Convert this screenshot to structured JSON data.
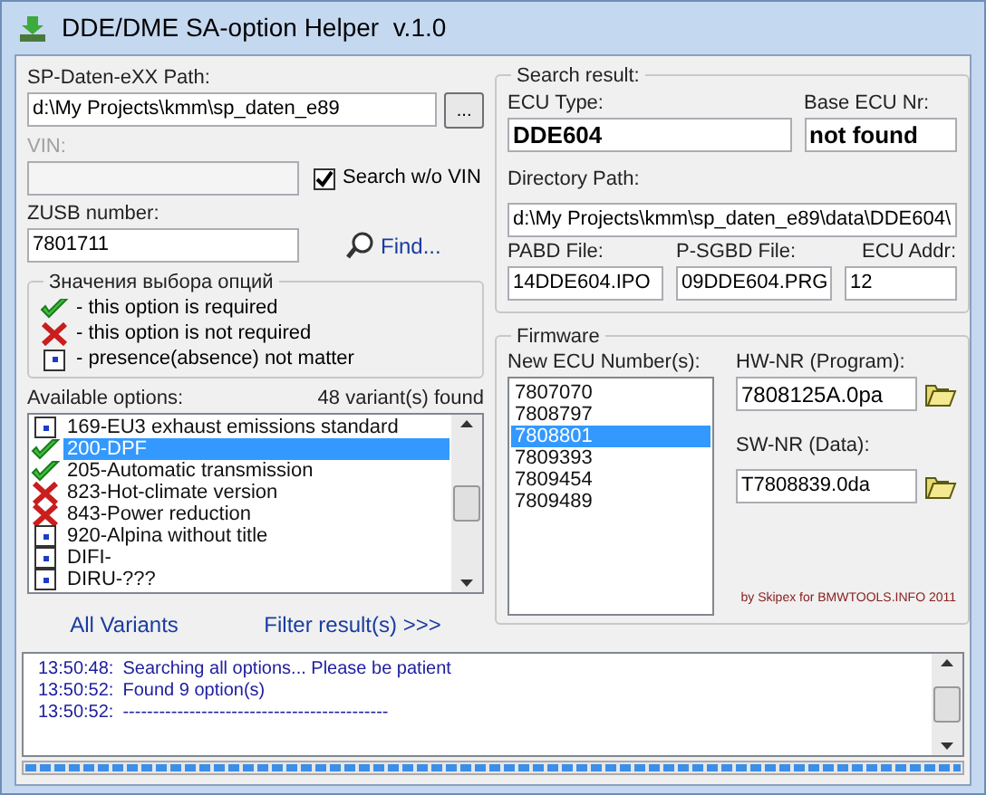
{
  "window": {
    "title": "DDE/DME SA-option Helper  v.1.0"
  },
  "sp_path": {
    "label": "SP-Daten-eXX Path:",
    "value": "d:\\My Projects\\kmm\\sp_daten_e89",
    "browse": "..."
  },
  "vin": {
    "label": "VIN:",
    "disabled": true,
    "search_without_vin": {
      "label": "Search w/o VIN",
      "checked": true
    }
  },
  "zusb": {
    "label": "ZUSB number:",
    "value": "7801711",
    "find": "Find..."
  },
  "legend": {
    "title": "Значения выбора опций",
    "items": [
      {
        "kind": "check",
        "text": "- this option is required"
      },
      {
        "kind": "cross",
        "text": "- this option is not required"
      },
      {
        "kind": "dot",
        "text": "- presence(absence) not matter"
      }
    ]
  },
  "options": {
    "label": "Available options:",
    "count": "48 variant(s) found",
    "items": [
      {
        "kind": "dot",
        "text": "169-EU3 exhaust emissions standard",
        "selected": false
      },
      {
        "kind": "check",
        "text": "200-DPF",
        "selected": true
      },
      {
        "kind": "check",
        "text": "205-Automatic transmission",
        "selected": false
      },
      {
        "kind": "cross",
        "text": "823-Hot-climate version",
        "selected": false
      },
      {
        "kind": "cross",
        "text": "843-Power reduction",
        "selected": false
      },
      {
        "kind": "dot",
        "text": "920-Alpina without title",
        "selected": false
      },
      {
        "kind": "dot",
        "text": "DIFI-",
        "selected": false
      },
      {
        "kind": "dot",
        "text": "DIRU-???",
        "selected": false
      }
    ]
  },
  "buttons": {
    "all_variants": "All Variants",
    "filter": "Filter result(s) >>>"
  },
  "search_result": {
    "title": "Search result:",
    "ecu_type": {
      "label": "ECU Type:",
      "value": "DDE604"
    },
    "base_ecu": {
      "label": "Base ECU Nr:",
      "value": "not found"
    },
    "directory": {
      "label": "Directory Path:",
      "value": "d:\\My Projects\\kmm\\sp_daten_e89\\data\\DDE604\\"
    },
    "pabd": {
      "label": "PABD File:",
      "value": "14DDE604.IPO"
    },
    "psgbd": {
      "label": "P-SGBD File:",
      "value": "09DDE604.PRG"
    },
    "ecu_addr": {
      "label": "ECU Addr:",
      "value": "12"
    }
  },
  "firmware": {
    "title": "Firmware",
    "ecu_numbers_label": "New ECU Number(s):",
    "ecu_numbers": [
      {
        "text": "7807070",
        "selected": false
      },
      {
        "text": "7808797",
        "selected": false
      },
      {
        "text": "7808801",
        "selected": true
      },
      {
        "text": "7809393",
        "selected": false
      },
      {
        "text": "7809454",
        "selected": false
      },
      {
        "text": "7809489",
        "selected": false
      }
    ],
    "hw": {
      "label": "HW-NR (Program):",
      "value": "7808125A.0pa"
    },
    "sw": {
      "label": "SW-NR (Data):",
      "value": "T7808839.0da"
    },
    "credit": "by Skipex for BMWTOOLS.INFO 2011"
  },
  "log": [
    {
      "time": "13:50:48:",
      "message": "Searching all options... Please be patient"
    },
    {
      "time": "13:50:52:",
      "message": "Found 9 option(s)"
    },
    {
      "time": "13:50:52:",
      "message": "--------------------------------------------"
    }
  ],
  "progress": {
    "level": 1
  }
}
